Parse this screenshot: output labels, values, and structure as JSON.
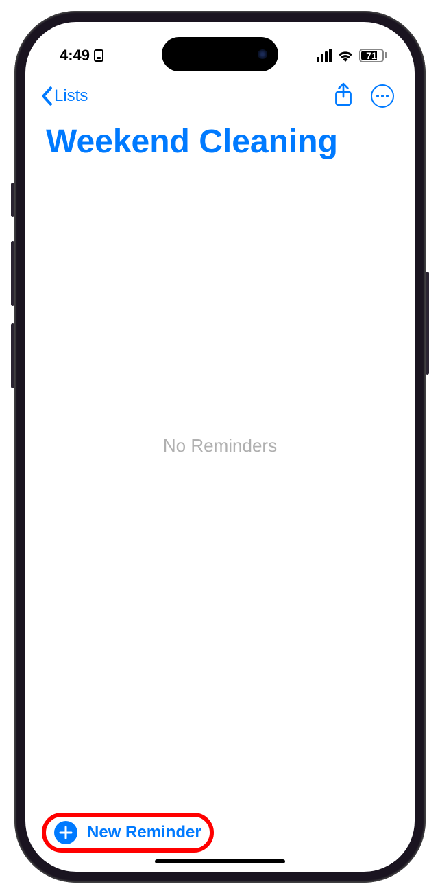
{
  "status": {
    "time": "4:49",
    "battery_pct": "71",
    "battery_fill_pct": 71
  },
  "nav": {
    "back_label": "Lists"
  },
  "header": {
    "title": "Weekend Cleaning"
  },
  "content": {
    "empty_message": "No Reminders"
  },
  "footer": {
    "new_reminder_label": "New Reminder"
  },
  "colors": {
    "accent": "#007AFF",
    "highlight": "#ff0000"
  }
}
